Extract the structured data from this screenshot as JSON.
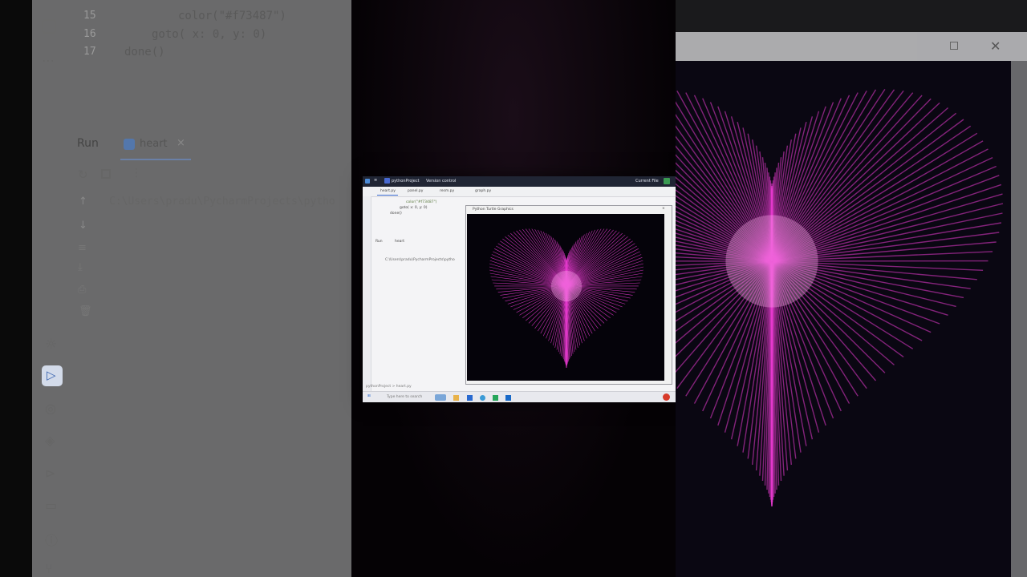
{
  "left_ide": {
    "lines": [
      {
        "num": "15",
        "code": "color(\"#f73487\")"
      },
      {
        "num": "16",
        "code": "goto( x: 0, y: 0)"
      },
      {
        "num": "17",
        "code": "done()"
      }
    ],
    "run_label": "Run",
    "run_tab": "heart",
    "console_path": "C:\\Users\\pradu\\PycharmProjects\\pytho"
  },
  "monitor": {
    "project": "pythonProject",
    "version_control": "Version control",
    "current_file": "Current File",
    "tabs": [
      "heart.py",
      "panel.py",
      "resm.py",
      "graph.py"
    ],
    "code_lines": [
      "color(\"#f73487\")",
      "goto( x: 0, y: 0)",
      "done()"
    ],
    "run_label": "Run",
    "run_tab": "heart",
    "console_path": "C:\\Users\\pradu\\PycharmProjects\\pytho",
    "turtle_title": "Python Turtle Graphics",
    "status_left": "pythonProject > heart.py",
    "search_placeholder": "Type here to search"
  },
  "colors": {
    "heart": "#e83ad0",
    "heart_core": "#ffb0ef",
    "canvas": "#05030a"
  }
}
